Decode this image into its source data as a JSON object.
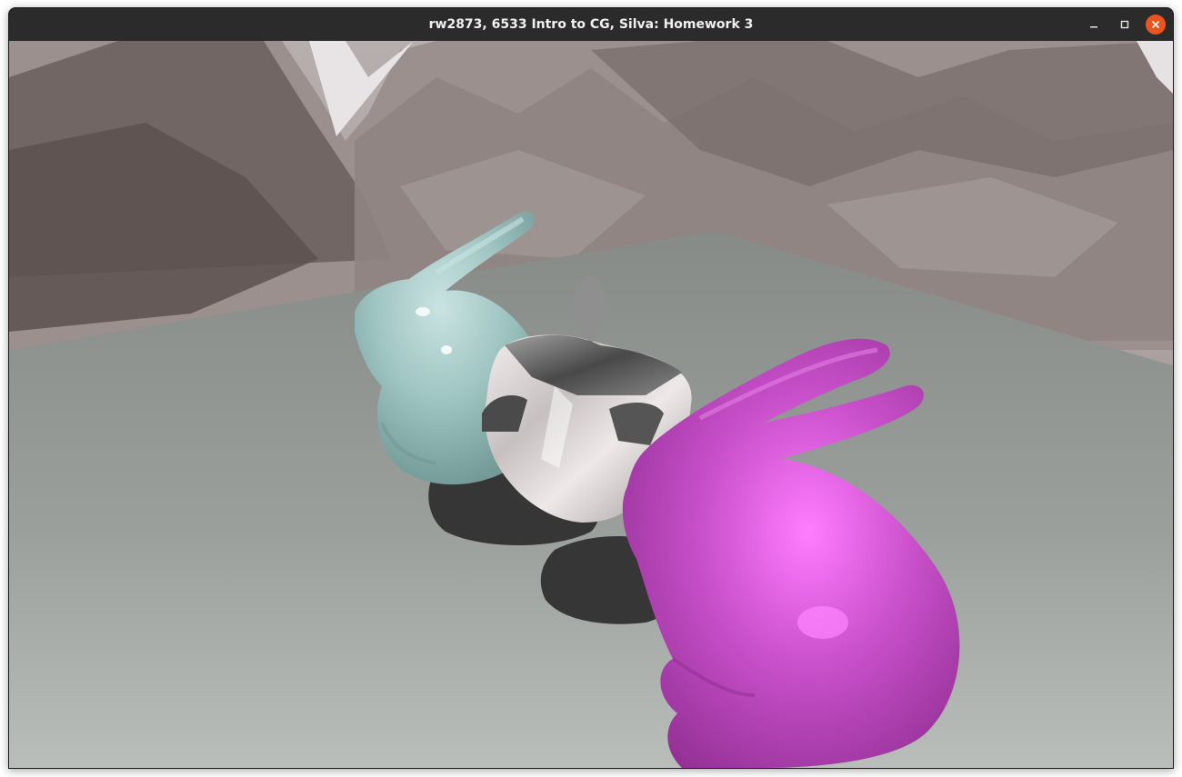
{
  "window": {
    "title": "rw2873, 6533 Intro to CG, Silva: Homework 3",
    "controls": {
      "minimize_icon": "minimize-icon",
      "maximize_icon": "maximize-icon",
      "close_icon": "close-icon"
    }
  },
  "scene": {
    "background": "mountain-skybox",
    "objects": [
      {
        "name": "bunny",
        "color": "#9cc3c0"
      },
      {
        "name": "reflective-cube",
        "color": "#c8c8c8"
      },
      {
        "name": "bunny",
        "color": "#c24fc4"
      }
    ],
    "colors": {
      "floor": "#8c918e",
      "shadow": "#363636",
      "accent_close": "#e95420"
    }
  }
}
